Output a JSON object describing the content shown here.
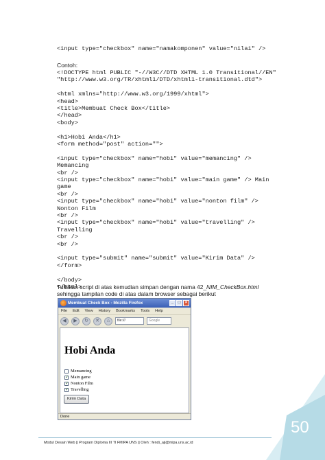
{
  "code_top": [
    "<input type=\"checkbox\" name=\"namakomponen\" value=\"nilai\" />"
  ],
  "contoh_label": "Contoh:",
  "code_main": [
    "<!DOCTYPE html PUBLIC \"-//W3C//DTD XHTML 1.0 Transitional//EN\"",
    "\"http://www.w3.org/TR/xhtml1/DTD/xhtml1-transitional.dtd\">",
    "",
    "<html xmlns=\"http://www.w3.org/1999/xhtml\">",
    "<head>",
    "<title>Membuat Check Box</title>",
    "</head>",
    "<body>",
    "",
    "<h1>Hobi Anda</h1>",
    "<form method=\"post\" action=\"\">",
    "",
    "<input type=\"checkbox\" name=\"hobi\" value=\"memancing\" />",
    "Memancing",
    "<br />",
    "<input type=\"checkbox\" name=\"hobi\" value=\"main game\" /> Main",
    "game",
    "<br />",
    "<input type=\"checkbox\" name=\"hobi\" value=\"nonton film\" />",
    "Nonton Film",
    "<br />",
    "<input type=\"checkbox\" name=\"hobi\" value=\"travelling\" />",
    "Travelling",
    "<br />",
    "<br />",
    "",
    "<input type=\"submit\" name=\"submit\" value=\"Kirim Data\" />",
    "</form>",
    "",
    "</body>",
    "</html>"
  ],
  "instruction": {
    "part1": "Tuliskan script di atas kemudian simpan dengan nama 42_",
    "filename": "NIM_CheckBox.html",
    "part2": " sehingga tampilan code di atas dalam browser sebagai berikut"
  },
  "browser": {
    "title": "Membuat Check Box - Mozilla Firefox",
    "menu": [
      "File",
      "Edit",
      "View",
      "History",
      "Bookmarks",
      "Tools",
      "Help"
    ],
    "url": "file:///",
    "search_placeholder": "Google",
    "heading": "Hobi Anda",
    "checkboxes": [
      {
        "label": "Memancing",
        "checked": false
      },
      {
        "label": "Main game",
        "checked": true
      },
      {
        "label": "Nonton Film",
        "checked": true
      },
      {
        "label": "Travelling",
        "checked": true
      }
    ],
    "submit_label": "Kirim Data",
    "status": "Done"
  },
  "page_number": "50",
  "footer": "Modul Desain Web || Program Diploma III TI FMIPA UNS || Oleh : fendi_aji@mipa.uns.ac.id",
  "colors": {
    "corner_dark": "#b6dbe6",
    "corner_light": "#d8edf3"
  }
}
